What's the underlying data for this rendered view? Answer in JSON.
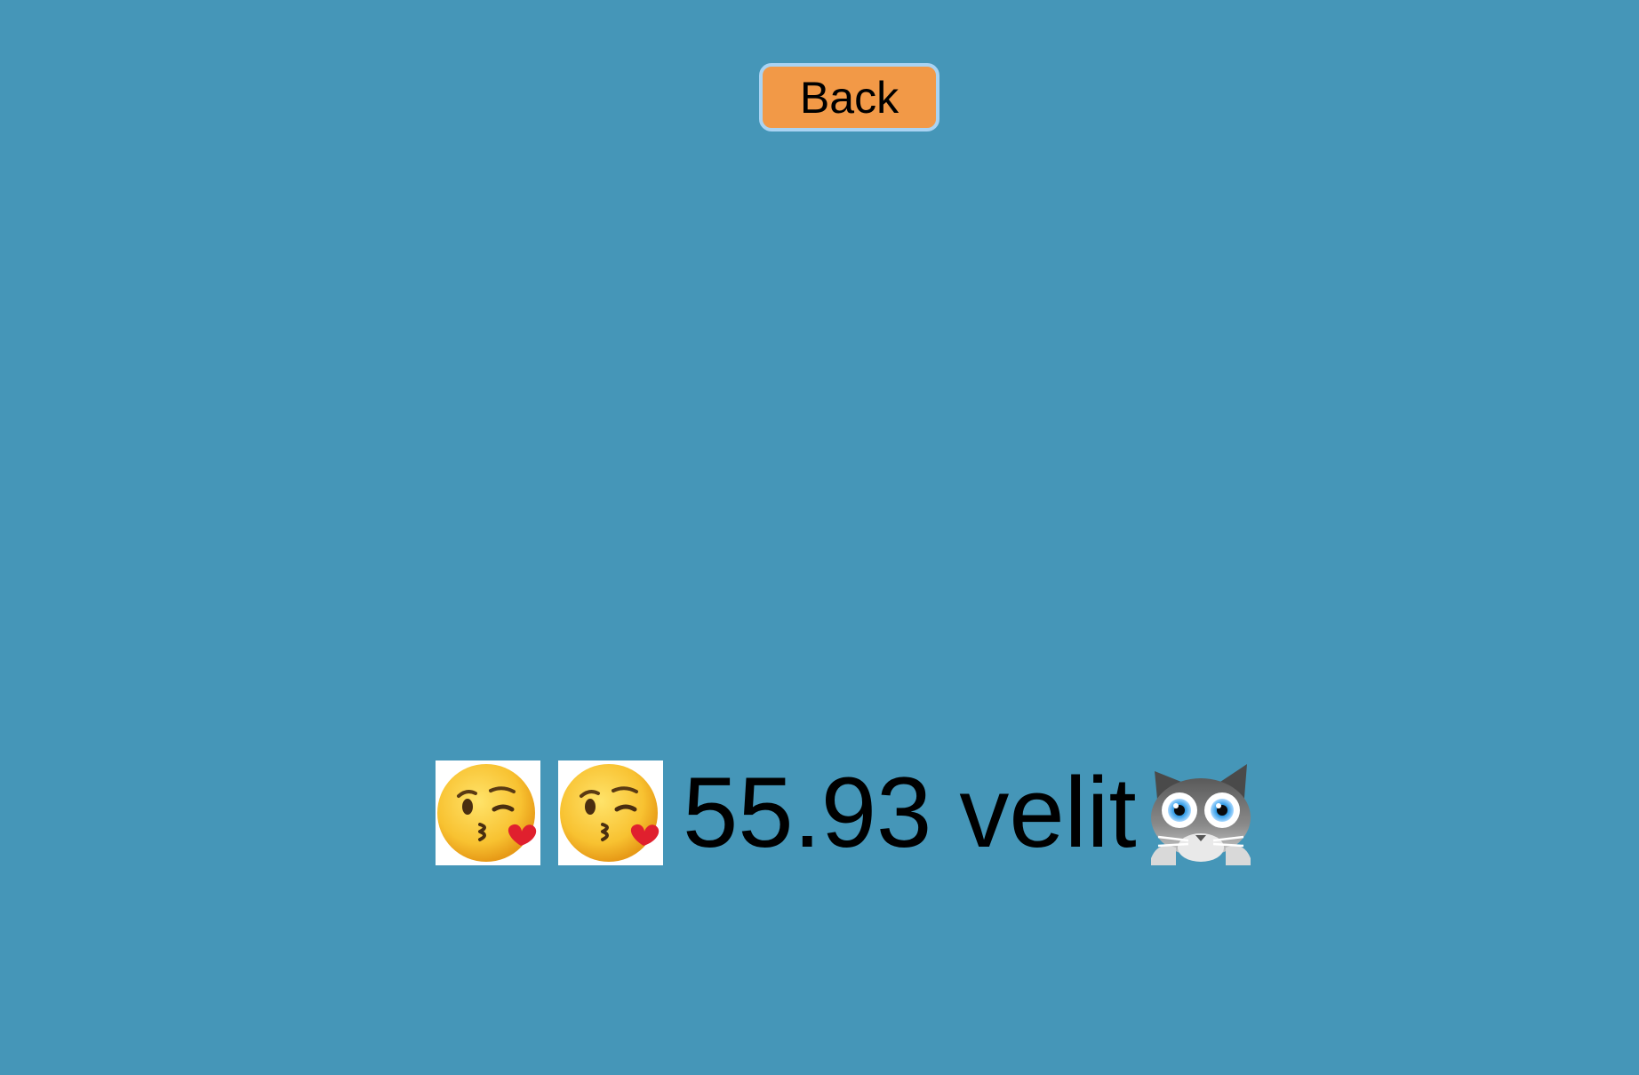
{
  "back_button": {
    "label": "Back"
  },
  "content": {
    "leading_icons": [
      "kissing-face-with-heart-icon",
      "kissing-face-with-heart-icon"
    ],
    "value_text": "55.93 velit",
    "trailing_icon": "cat-face-icon"
  },
  "colors": {
    "background": "#4596b8",
    "button_fill": "#f29947",
    "button_border": "#a9d3f3"
  }
}
